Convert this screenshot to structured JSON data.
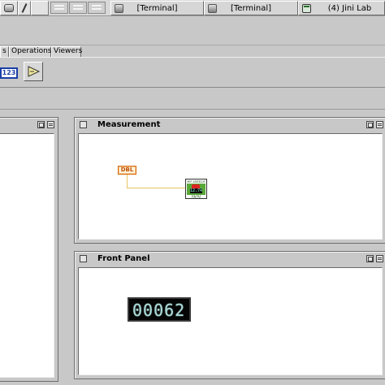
{
  "taskbar": {
    "tasks": [
      {
        "label": "[Terminal]"
      },
      {
        "label": "[Terminal]"
      },
      {
        "label": "(4) Jini Lab"
      }
    ]
  },
  "tabs": [
    {
      "label": "s"
    },
    {
      "label": "Operations"
    },
    {
      "label": "Viewers"
    }
  ],
  "palette": {
    "numeric_label": "123"
  },
  "windows": {
    "measurement": {
      "title": "Measurement",
      "dbl_label": "DBL",
      "vi_header": "HP 34401A",
      "vi_display": "12.74",
      "vi_footer": "READ MEAS"
    },
    "front_panel": {
      "title": "Front Panel",
      "display_value": "00062"
    }
  }
}
